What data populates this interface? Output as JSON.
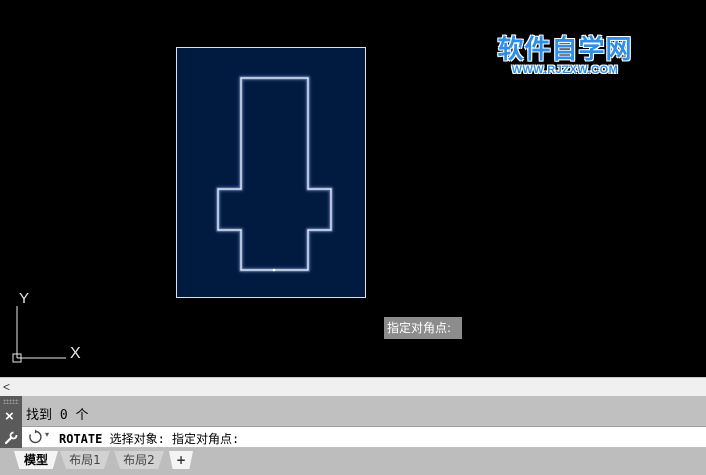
{
  "watermark": {
    "title": "软件自学网",
    "url": "WWW.RJZXW.COM"
  },
  "canvas": {
    "tooltip": "指定对角点:",
    "ucs": {
      "y_label": "Y",
      "x_label": "X"
    }
  },
  "scrollbar": {
    "left_arrow": "<"
  },
  "command": {
    "close_label": "×",
    "history_line": "找到 0 个",
    "keyword": "ROTATE",
    "prompt": " 选择对象: 指定对角点:",
    "dropdown": "▾"
  },
  "tabs": {
    "model": "模型",
    "layout1": "布局1",
    "layout2": "布局2",
    "add": "+"
  },
  "colors": {
    "canvas_bg": "#000000",
    "selection_fill": "#001a40",
    "shape_stroke": "#e8f0ff",
    "watermark_blue": "#2f8fe8",
    "tooltip_bg": "#8c8c8c"
  }
}
